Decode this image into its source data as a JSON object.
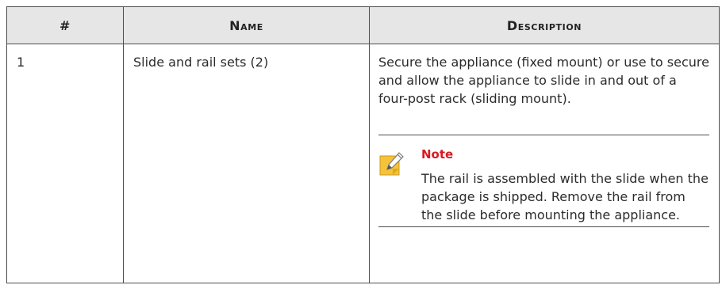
{
  "table": {
    "headers": [
      "#",
      "Name",
      "Description"
    ],
    "rows": [
      {
        "number": "1",
        "name": "Slide and rail sets (2)",
        "description": "Secure the appliance (fixed mount) or use to secure and allow the appliance to slide in and out of a four-post rack (sliding mount).",
        "note": {
          "icon": "note-pencil-icon",
          "title": "Note",
          "text": "The rail is assembled with the slide when the package is shipped. Remove the rail from the slide before mounting the appliance."
        }
      }
    ]
  },
  "colors": {
    "header_bg": "#e6e6e6",
    "note_title": "#d71920",
    "icon_yellow": "#f5c33b",
    "border": "#4d4d4d"
  }
}
